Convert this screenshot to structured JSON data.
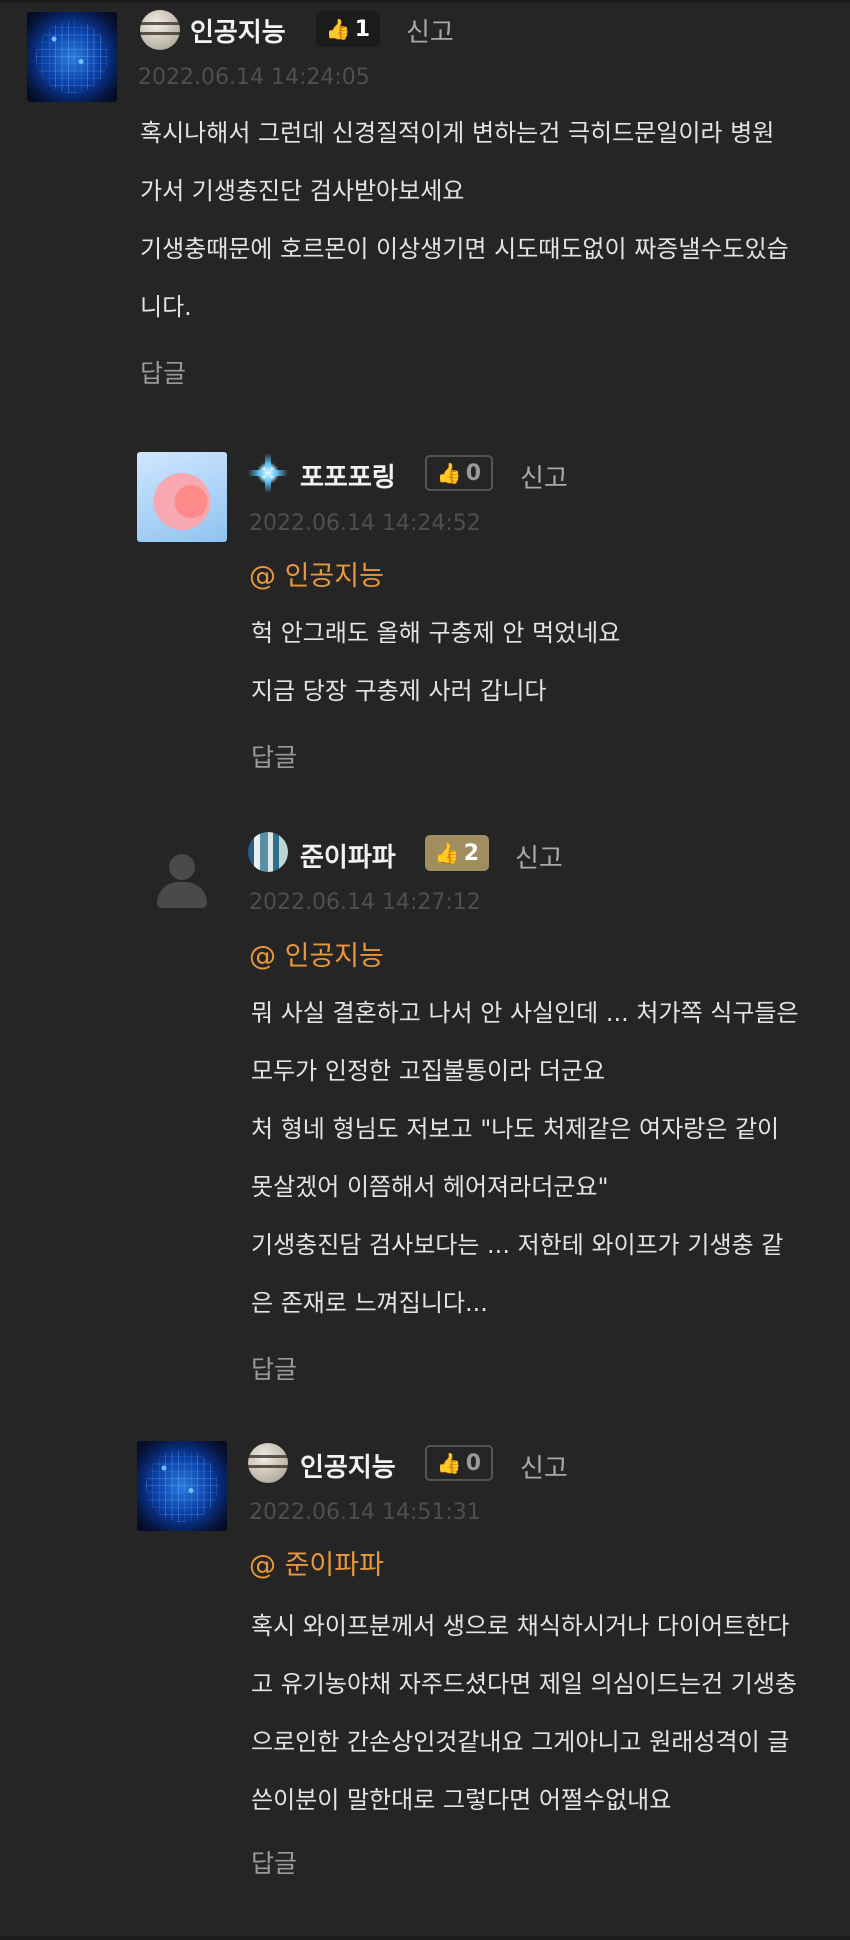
{
  "comments": [
    {
      "nickname": "인공지능",
      "likes": "1",
      "report": "신고",
      "timestamp": "2022.06.14 14:24:05",
      "mention": "",
      "lines": [
        "혹시나해서 그런데 신경질적이게 변하는건 극히드문일이라 병원",
        "가서 기생충진단 검사받아보세요",
        "기생충때문에 호르몬이 이상생기면 시도때도없이 짜증낼수도있습",
        "니다."
      ],
      "reply": "답글"
    },
    {
      "nickname": "포포포링",
      "likes": "0",
      "report": "신고",
      "timestamp": "2022.06.14 14:24:52",
      "mention": "@ 인공지능",
      "lines": [
        "헉 안그래도 올해 구충제 안 먹었네요",
        "지금 당장 구충제 사러 갑니다"
      ],
      "reply": "답글"
    },
    {
      "nickname": "준이파파",
      "likes": "2",
      "report": "신고",
      "timestamp": "2022.06.14 14:27:12",
      "mention": "@ 인공지능",
      "lines": [
        "뭐 사실 결혼하고 나서 안 사실인데 ... 처가쪽 식구들은",
        "모두가 인정한 고집불통이라 더군요",
        "처 형네 형님도  저보고 \"나도 처제같은 여자랑은 같이",
        "못살겠어 이쯤해서 헤어져라더군요\"",
        "기생충진담 검사보다는  ... 저한테  와이프가 기생충 같",
        "은 존재로 느껴집니다..."
      ],
      "reply": "답글"
    },
    {
      "nickname": "인공지능",
      "likes": "0",
      "report": "신고",
      "timestamp": "2022.06.14 14:51:31",
      "mention": "@ 준이파파",
      "lines": [
        "혹시 와이프분께서 생으로 채식하시거나 다이어트한다",
        "고 유기농야채 자주드셨다면 제일 의심이드는건 기생충",
        "으로인한 간손상인것같내요 그게아니고 원래성격이 글",
        "쓴이분이 말한대로 그렇다면 어쩔수없내요"
      ],
      "reply": "답글"
    }
  ],
  "icons": {
    "like": "thumbs-up-icon",
    "avatar_default": "person-icon"
  },
  "colors": {
    "background": "#252525",
    "mention": "#e8973a",
    "like_active": "#a08d60"
  }
}
